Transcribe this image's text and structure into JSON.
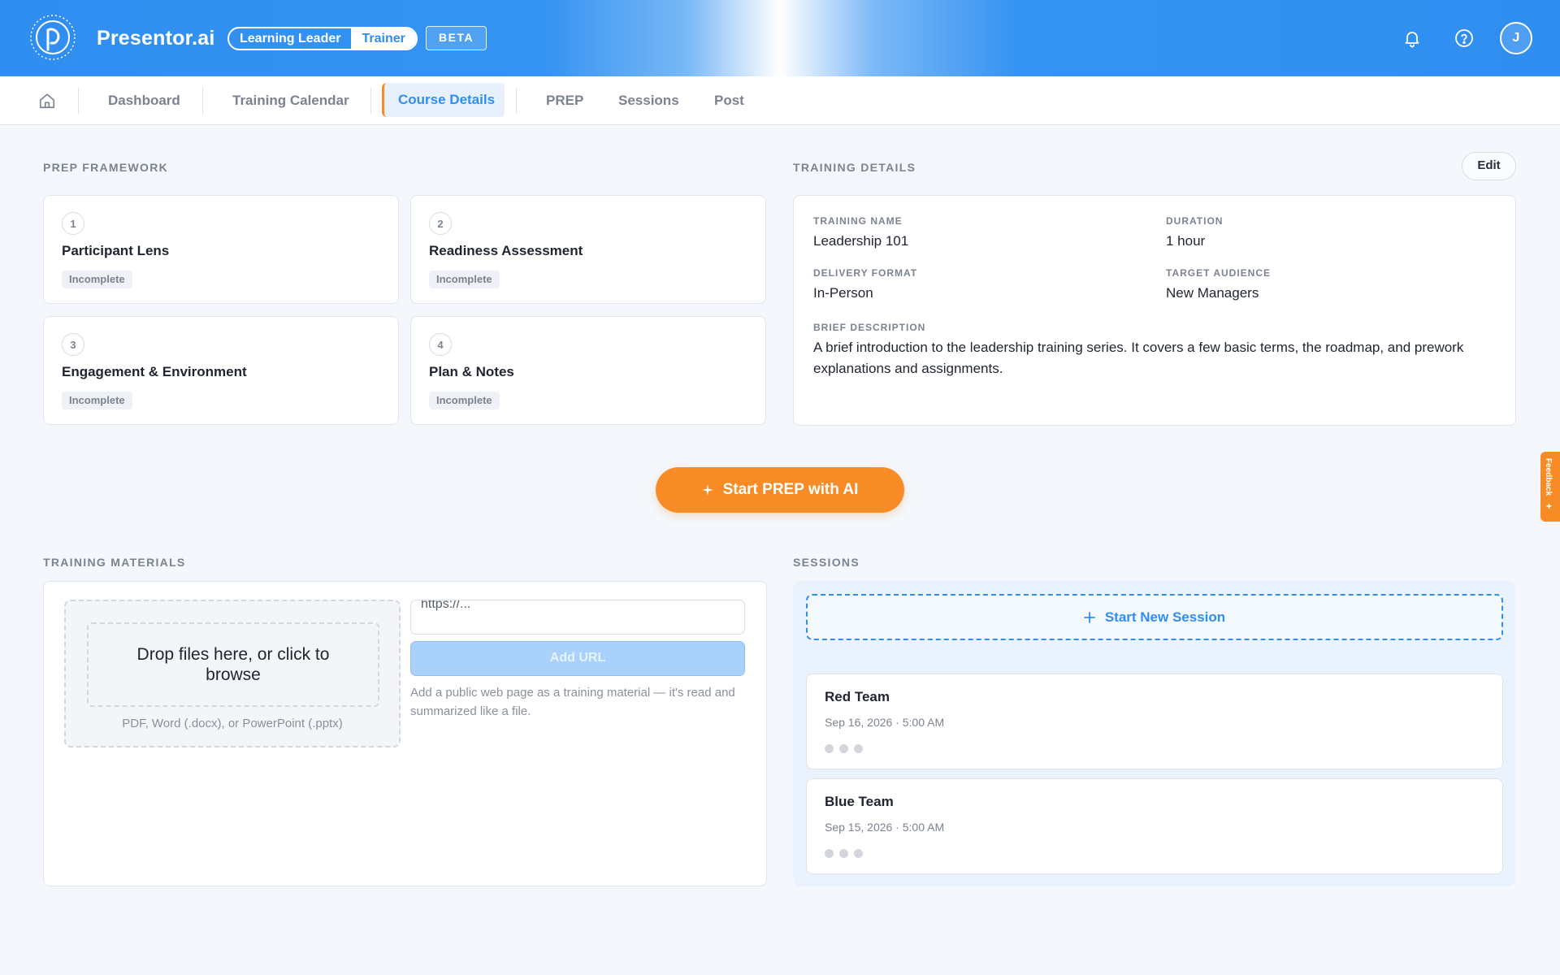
{
  "header": {
    "brand": "Presentor.ai",
    "roles": [
      "Learning Leader",
      "Trainer"
    ],
    "active_role": "Trainer",
    "beta_label": "BETA",
    "user_initial": "J",
    "colors": {
      "primary": "#2f8ef0",
      "accent": "#f78c26"
    }
  },
  "nav": {
    "items": [
      "Dashboard",
      "Training Calendar",
      "Course Details",
      "PREP",
      "Sessions",
      "Post"
    ],
    "active": "Course Details"
  },
  "prep_framework": {
    "title": "PREP FRAMEWORK",
    "steps": [
      {
        "number": "1",
        "title": "Participant Lens",
        "status": "Incomplete"
      },
      {
        "number": "2",
        "title": "Readiness Assessment",
        "status": "Incomplete"
      },
      {
        "number": "3",
        "title": "Engagement & Environment",
        "status": "Incomplete"
      },
      {
        "number": "4",
        "title": "Plan & Notes",
        "status": "Incomplete"
      }
    ]
  },
  "training_details": {
    "title": "TRAINING DETAILS",
    "edit_label": "Edit",
    "fields": {
      "training_name_label": "TRAINING NAME",
      "training_name": "Leadership 101",
      "duration_label": "DURATION",
      "duration": "1 hour",
      "delivery_format_label": "DELIVERY FORMAT",
      "delivery_format": "In-Person",
      "target_audience_label": "TARGET AUDIENCE",
      "target_audience": "New Managers",
      "brief_description_label": "BRIEF DESCRIPTION",
      "brief_description": "A brief introduction to the leadership training series. It covers a few basic terms, the roadmap, and prework explanations and assignments."
    }
  },
  "cta": {
    "label": "Start PREP with AI"
  },
  "training_materials": {
    "title": "TRAINING MATERIALS",
    "dropzone_text": "Drop files here, or click to browse",
    "dropzone_hint": "PDF, Word (.docx), or PowerPoint (.pptx)",
    "url_placeholder": "https://...",
    "add_url_label": "Add URL",
    "url_help": "Add a public web page as a training material — it's read and summarized like a file."
  },
  "sessions": {
    "title": "SESSIONS",
    "new_session_label": "Start New Session",
    "items": [
      {
        "name": "Red Team",
        "date": "Sep 16, 2026 · 5:00 AM"
      },
      {
        "name": "Blue Team",
        "date": "Sep 15, 2026 · 5:00 AM"
      }
    ]
  },
  "side_tab": {
    "label": "Feedback"
  }
}
